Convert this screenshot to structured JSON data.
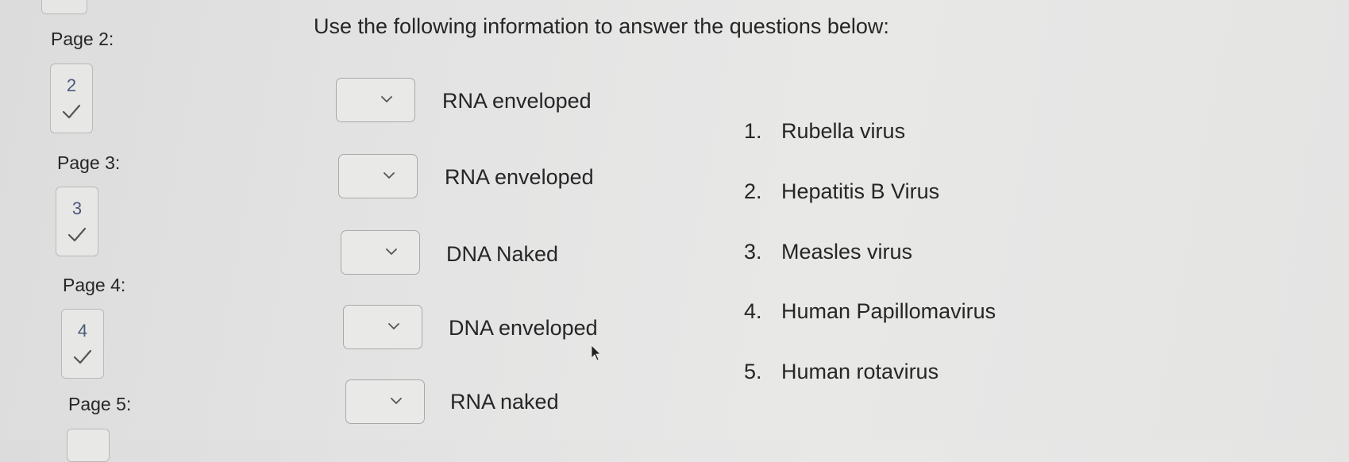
{
  "sidebar": {
    "pages": [
      {
        "label": "Page 2:",
        "number": "2",
        "status": "answered"
      },
      {
        "label": "Page 3:",
        "number": "3",
        "status": "answered"
      },
      {
        "label": "Page 4:",
        "number": "4",
        "status": "answered"
      },
      {
        "label": "Page 5:",
        "number": "",
        "status": "unknown"
      }
    ]
  },
  "main": {
    "instructions": "Use the following information to answer the questions below:",
    "matching": [
      {
        "selected": "",
        "label": "RNA enveloped"
      },
      {
        "selected": "",
        "label": "RNA enveloped"
      },
      {
        "selected": "",
        "label": "DNA Naked"
      },
      {
        "selected": "",
        "label": "DNA enveloped"
      },
      {
        "selected": "",
        "label": "RNA naked"
      }
    ],
    "options": [
      {
        "number": "1.",
        "text": "Rubella virus"
      },
      {
        "number": "2.",
        "text": "Hepatitis B Virus"
      },
      {
        "number": "3.",
        "text": "Measles virus"
      },
      {
        "number": "4.",
        "text": "Human Papillomavirus"
      },
      {
        "number": "5.",
        "text": "Human rotavirus"
      }
    ]
  },
  "colors": {
    "check": "#555555",
    "page_number": "#4a5a78",
    "border": "#b9b9b9"
  },
  "icons": [
    "checkmark-icon",
    "chevron-down-icon",
    "mouse-cursor-icon"
  ]
}
